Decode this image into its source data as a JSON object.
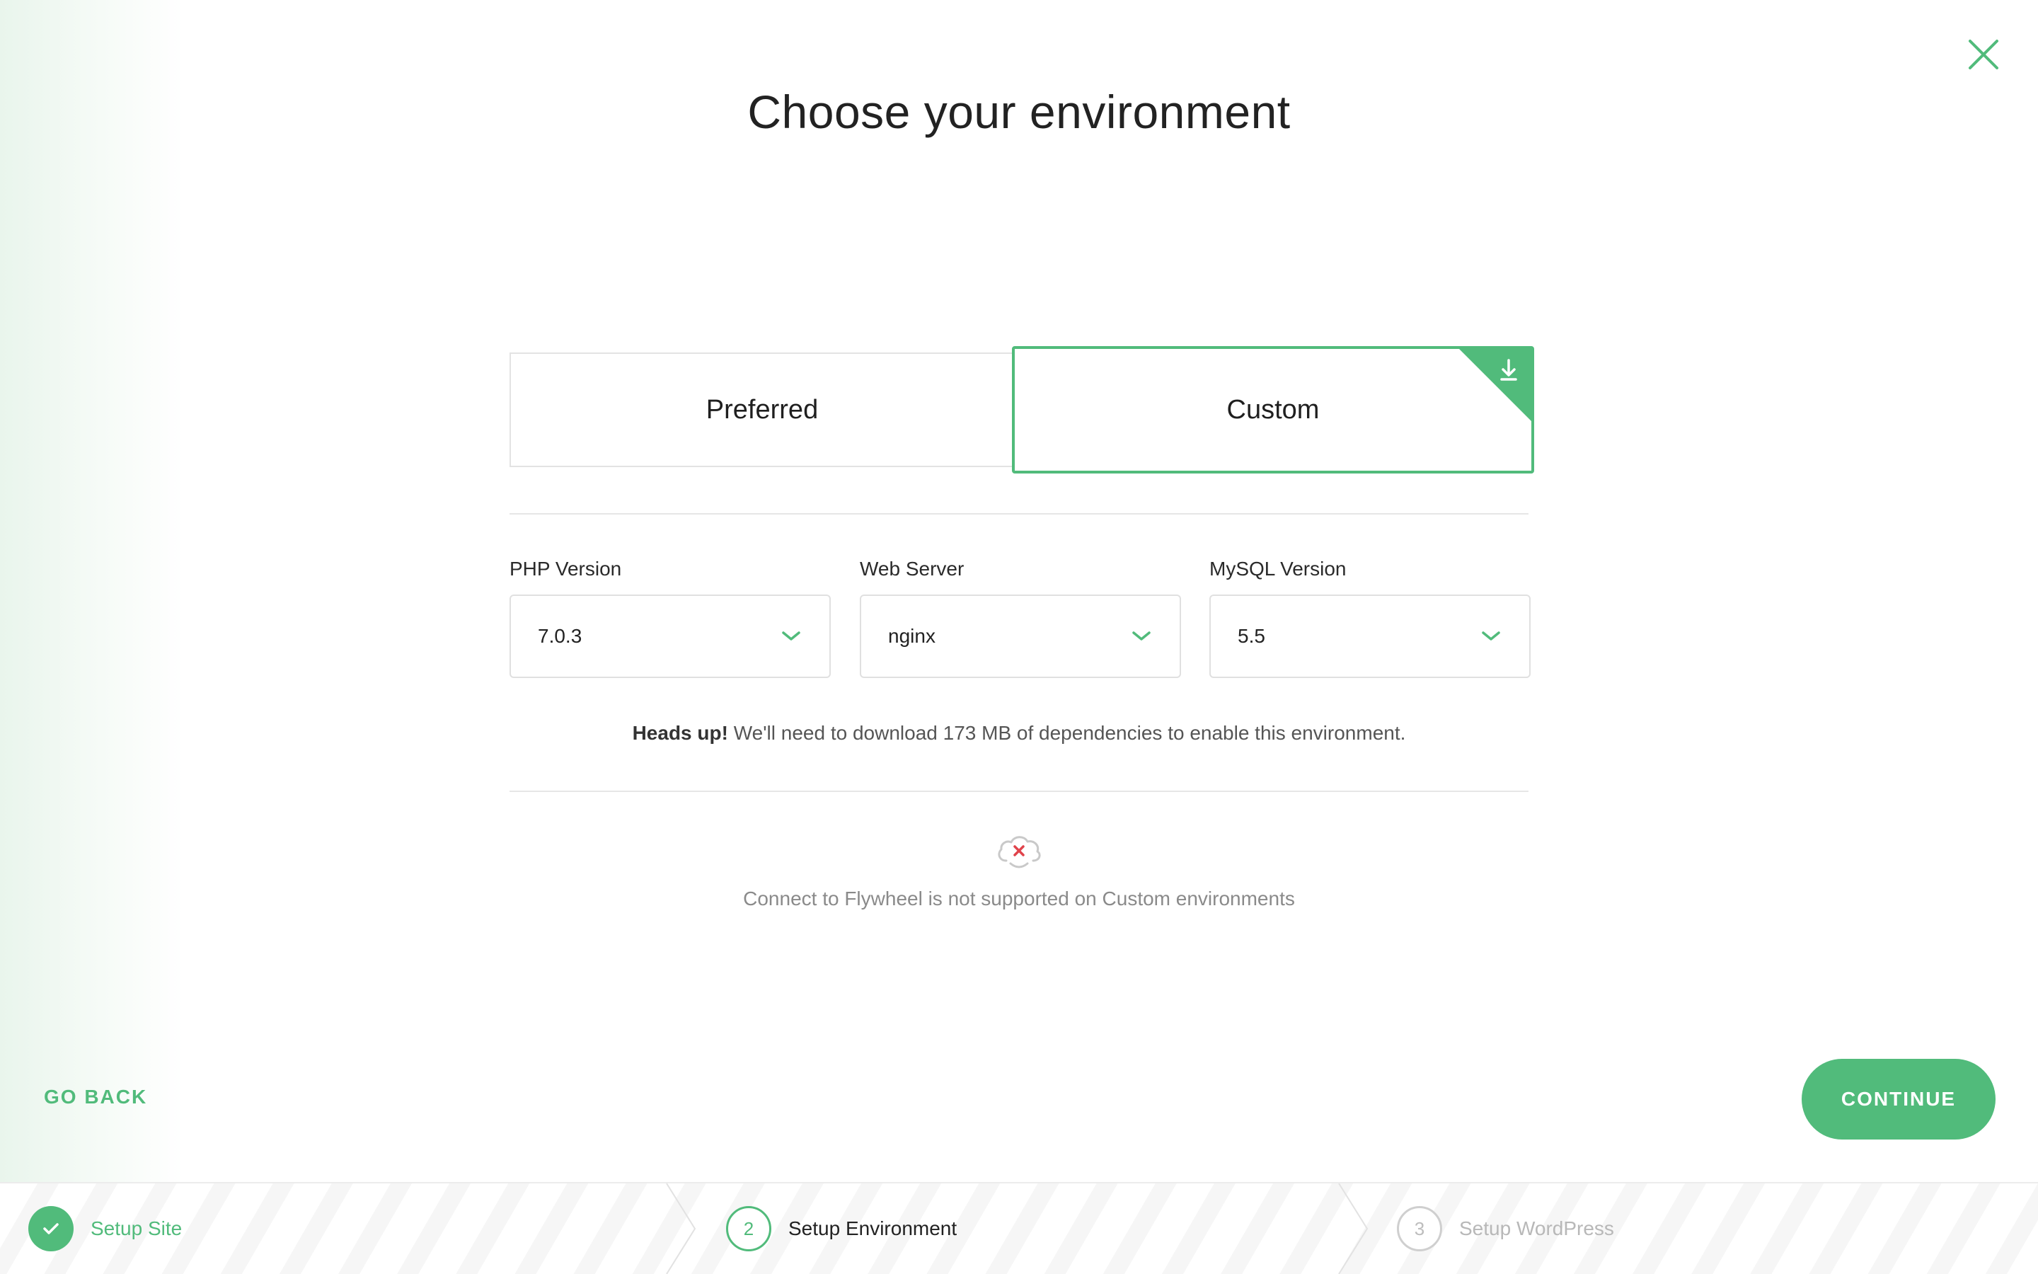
{
  "title": "Choose your environment",
  "tabs": {
    "preferred": "Preferred",
    "custom": "Custom"
  },
  "fields": [
    {
      "label": "PHP Version",
      "value": "7.0.3"
    },
    {
      "label": "Web Server",
      "value": "nginx"
    },
    {
      "label": "MySQL Version",
      "value": "5.5"
    }
  ],
  "headsup": {
    "bold": "Heads up!",
    "text": " We'll need to download 173 MB of dependencies to enable this environment."
  },
  "notice": "Connect to Flywheel is not supported on Custom environments",
  "actions": {
    "go_back": "GO BACK",
    "continue": "CONTINUE"
  },
  "steps": [
    {
      "number": "1",
      "label": "Setup Site",
      "state": "complete"
    },
    {
      "number": "2",
      "label": "Setup Environment",
      "state": "active"
    },
    {
      "number": "3",
      "label": "Setup WordPress",
      "state": "pending"
    }
  ],
  "colors": {
    "accent": "#51bb7b",
    "error": "#e0434b"
  },
  "icons": {
    "close": "close-icon",
    "corner_download": "download-icon",
    "select_chevron": "chevron-down-icon",
    "cloud_error": "cloud-error-icon",
    "step_complete": "check-icon"
  }
}
